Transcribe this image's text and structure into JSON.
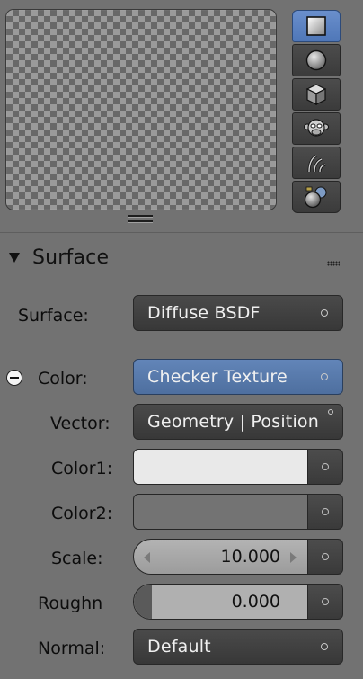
{
  "preview": {
    "shapes": [
      {
        "name": "flat",
        "icon": "flat-plane-icon",
        "active": true
      },
      {
        "name": "sphere",
        "icon": "sphere-icon",
        "active": false
      },
      {
        "name": "cube",
        "icon": "cube-icon",
        "active": false
      },
      {
        "name": "monkey",
        "icon": "monkey-icon",
        "active": false
      },
      {
        "name": "hair",
        "icon": "hair-strands-icon",
        "active": false
      },
      {
        "name": "world-sphere",
        "icon": "world-sphere-icon",
        "active": false
      }
    ]
  },
  "panel": {
    "title": "Surface",
    "rows": [
      {
        "label": "Surface:",
        "value": "Diffuse BSDF"
      },
      {
        "label": "Color:",
        "value": "Checker Texture"
      },
      {
        "label": "Vector:",
        "value": "Geometry | Position"
      },
      {
        "label": "Color1:",
        "color": "#e9e9e9"
      },
      {
        "label": "Color2:",
        "color": "#737373"
      },
      {
        "label": "Scale:",
        "value": "10.000"
      },
      {
        "label": "Roughn",
        "value": "0.000",
        "fraction": 0.0
      },
      {
        "label": "Normal:",
        "value": "Default"
      }
    ]
  },
  "colors": {
    "accent": "#5b7fb5",
    "panel_bg": "#727272",
    "widget_dark": "#404040"
  }
}
